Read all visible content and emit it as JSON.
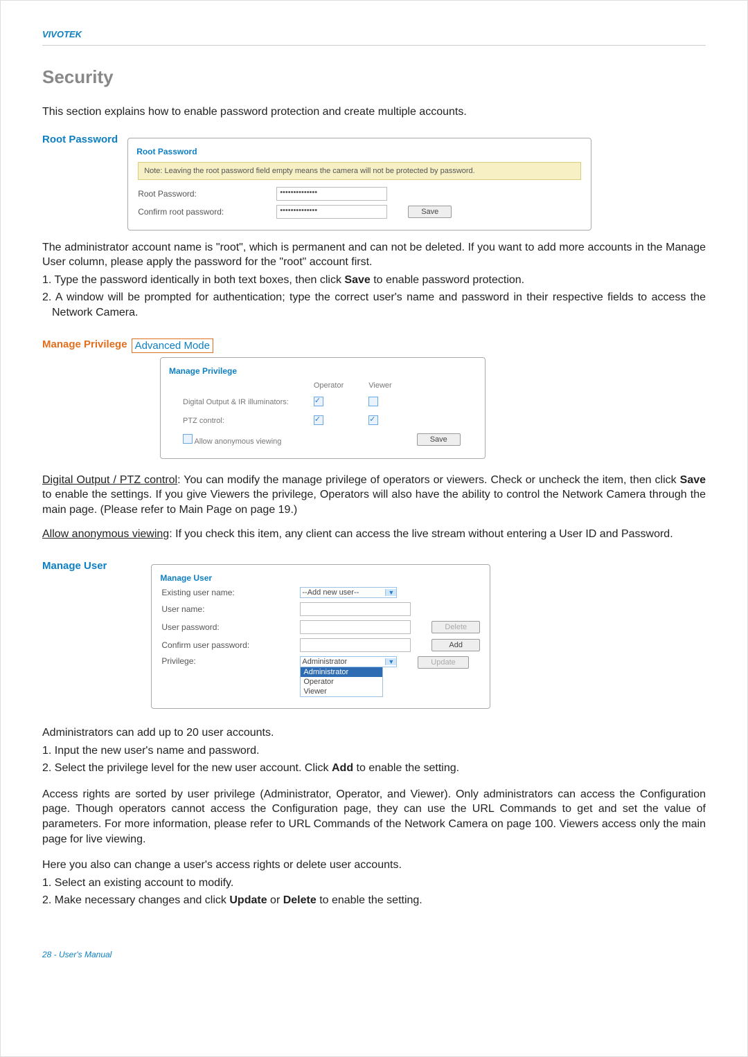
{
  "header": {
    "brand": "VIVOTEK"
  },
  "h1": "Security",
  "intro": "This section explains how to enable password protection and create multiple accounts.",
  "rootPw": {
    "heading": "Root Password",
    "legend": "Root Password",
    "note": "Note: Leaving the root password field empty means the camera will not be protected by password.",
    "row1Label": "Root Password:",
    "row1Value": "••••••••••••••",
    "row2Label": "Confirm root password:",
    "row2Value": "••••••••••••••",
    "saveLabel": "Save",
    "para1a": "The administrator account name is \"root\", which is permanent and can not be deleted. If you want to add more accounts in the Manage User column, please apply the password for the \"root\" account first.",
    "para1b": "1. Type the password identically in both text boxes, then click ",
    "para1bBold": "Save",
    "para1bEnd": " to enable password protection.",
    "para1c": "2. A window will be prompted for authentication; type the correct user's name and password in their respective fields to access the Network Camera."
  },
  "managePriv": {
    "heading": "Manage Privilege",
    "advMode": "Advanced Mode",
    "legend": "Manage Privilege",
    "cols": [
      "Operator",
      "Viewer"
    ],
    "rows": [
      {
        "label": "Digital Output & IR illuminators:",
        "op": true,
        "vw": false
      },
      {
        "label": "PTZ control:",
        "op": true,
        "vw": true
      }
    ],
    "anonLabel": "Allow anonymous viewing",
    "saveLabel": "Save",
    "paraA_u": "Digital Output / PTZ control",
    "paraA": ": You can modify the manage privilege of operators or viewers. Check or uncheck the item, then click ",
    "paraA_bold": "Save",
    "paraA_end": " to enable the settings. If you give Viewers the privilege, Operators will also have the ability to control the Network Camera through the main page. (Please refer to Main Page on page 19.)",
    "paraB_u": "Allow anonymous viewing",
    "paraB": ": If you check this item, any client can access the live stream without entering a User ID and Password."
  },
  "manageUser": {
    "heading": "Manage User",
    "legend": "Manage User",
    "rows": {
      "existingLabel": "Existing user name:",
      "existingValue": "--Add new user--",
      "usernameLabel": "User name:",
      "userpwLabel": "User password:",
      "confirmLabel": "Confirm user password:",
      "privLabel": "Privilege:",
      "privValue": "Administrator",
      "options": [
        "Administrator",
        "Operator",
        "Viewer"
      ]
    },
    "btnDelete": "Delete",
    "btnAdd": "Add",
    "btnUpdate": "Update",
    "para1": "Administrators can add up to 20 user accounts.",
    "para2": "1. Input the new user's name and password.",
    "para3a": "2. Select the privilege level for the new user account. Click ",
    "para3bold": "Add",
    "para3b": " to enable the setting.",
    "para4": "Access rights are sorted by user privilege (Administrator, Operator, and Viewer). Only administrators can access the Configuration page. Though operators cannot access the Configuration page, they can use the URL Commands to get and set the value of parameters. For more information, please refer to URL Commands of the Network Camera on page 100. Viewers access only the main page for live viewing.",
    "para5": "Here you also can change a user's access rights or delete user accounts.",
    "para6": "1. Select an existing account to modify.",
    "para7a": "2. Make necessary changes and click ",
    "para7b1": "Update",
    "para7mid": " or ",
    "para7b2": "Delete",
    "para7end": " to enable the setting."
  },
  "footer": "28 - User's Manual"
}
